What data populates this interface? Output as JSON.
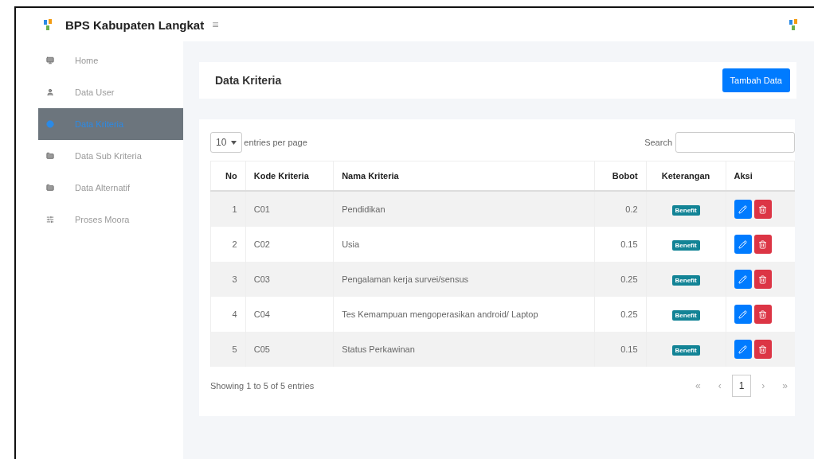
{
  "header": {
    "brand": "BPS Kabupaten Langkat",
    "menu_toggle": "≡"
  },
  "sidebar": {
    "items": [
      {
        "label": "Home",
        "selected": false
      },
      {
        "label": "Data User",
        "selected": false
      },
      {
        "label": "Data Kriteria",
        "selected": true
      },
      {
        "label": "Data Sub Kriteria",
        "selected": false
      },
      {
        "label": "Data Alternatif",
        "selected": false
      },
      {
        "label": "Proses Moora",
        "selected": false
      }
    ]
  },
  "page": {
    "title": "Data Kriteria",
    "add_button": "Tambah Data"
  },
  "table_controls": {
    "page_size": "10",
    "page_size_label": "entries per page",
    "search_label": "Search"
  },
  "table": {
    "columns": [
      "No",
      "Kode Kriteria",
      "Nama Kriteria",
      "Bobot",
      "Keterangan",
      "Aksi"
    ],
    "rows": [
      {
        "no": "1",
        "code": "C01",
        "name": "Pendidikan",
        "weight": "0.2",
        "type": "Benefit"
      },
      {
        "no": "2",
        "code": "C02",
        "name": "Usia",
        "weight": "0.15",
        "type": "Benefit"
      },
      {
        "no": "3",
        "code": "C03",
        "name": "Pengalaman kerja survei/sensus",
        "weight": "0.25",
        "type": "Benefit"
      },
      {
        "no": "4",
        "code": "C04",
        "name": "Tes Kemampuan mengoperasikan android/ Laptop",
        "weight": "0.25",
        "type": "Benefit"
      },
      {
        "no": "5",
        "code": "C05",
        "name": "Status Perkawinan",
        "weight": "0.15",
        "type": "Benefit"
      }
    ]
  },
  "footer": {
    "info": "Showing 1 to 5 of 5 entries",
    "pagination": [
      {
        "label": "«",
        "selected": false
      },
      {
        "label": "‹",
        "selected": false
      },
      {
        "label": "1",
        "selected": true
      },
      {
        "label": "›",
        "selected": false
      },
      {
        "label": "»",
        "selected": false
      }
    ]
  }
}
